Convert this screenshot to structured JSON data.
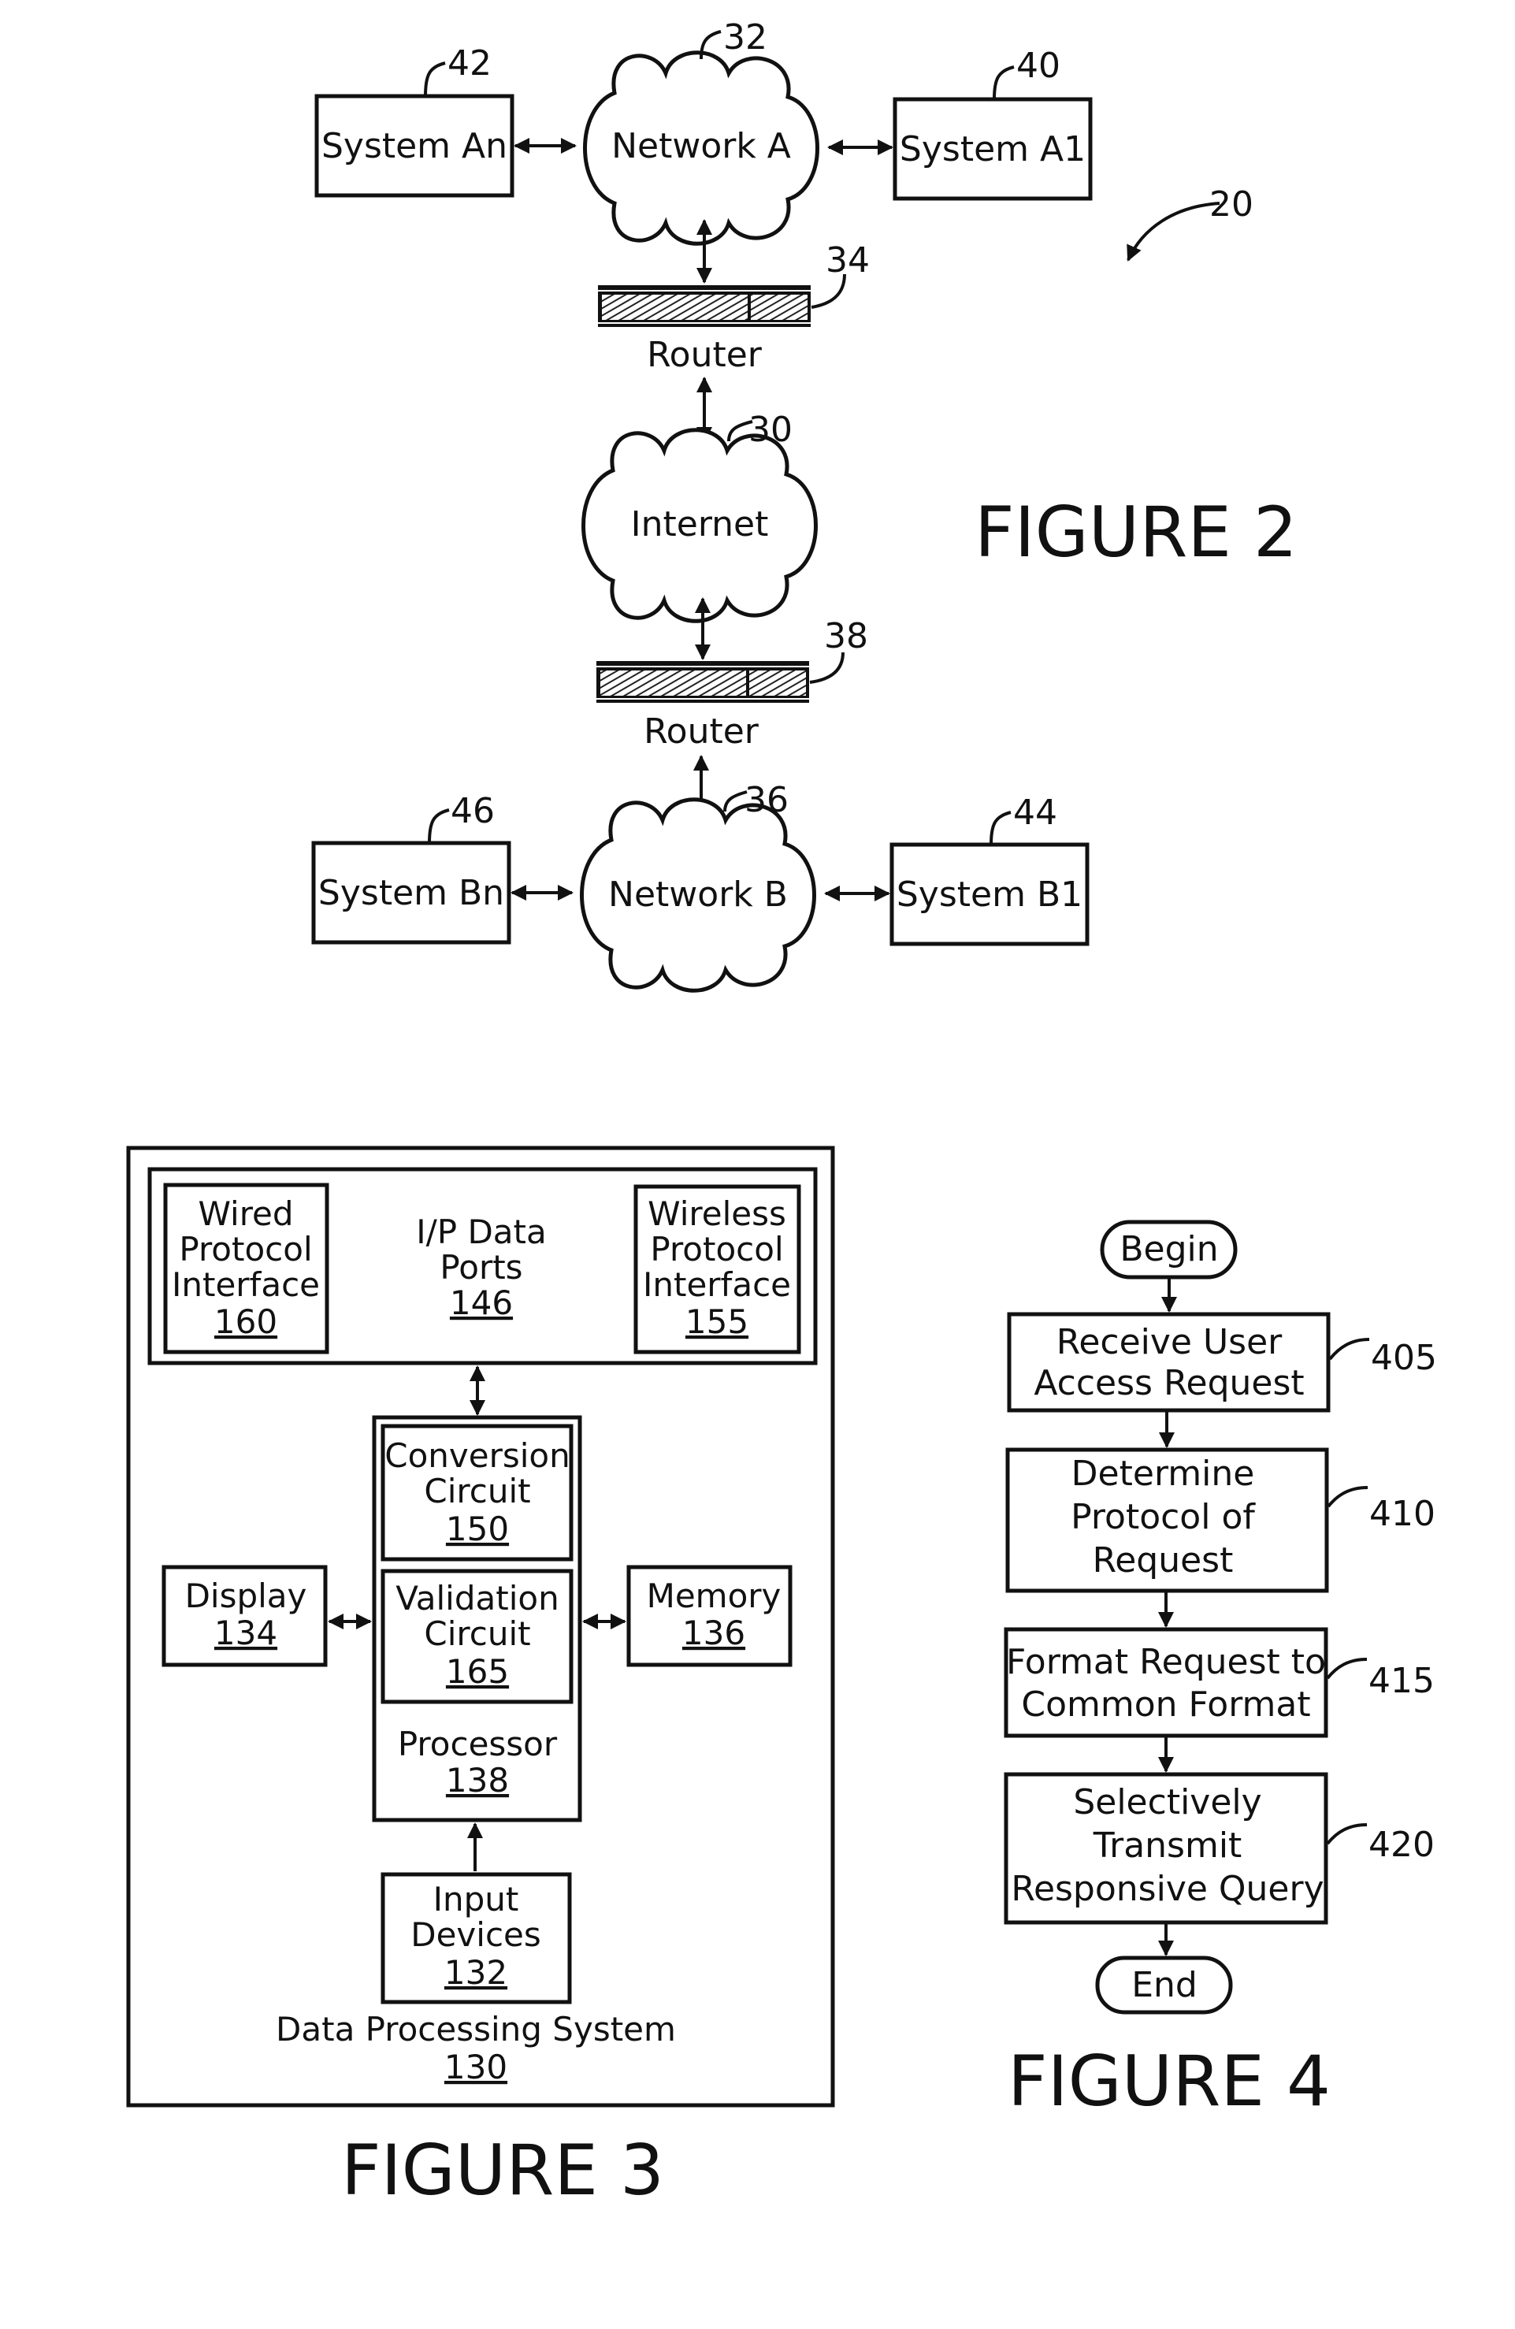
{
  "figure2": {
    "caption": "FIGURE 2",
    "ref": "20",
    "system_an": {
      "label": "System An",
      "ref": "42"
    },
    "network_a": {
      "label": "Network A",
      "ref": "32"
    },
    "system_a1": {
      "label": "System A1",
      "ref": "40"
    },
    "router_a": {
      "label": "Router",
      "ref": "34"
    },
    "internet": {
      "label": "Internet",
      "ref": "30"
    },
    "router_b": {
      "label": "Router",
      "ref": "38"
    },
    "system_bn": {
      "label": "System Bn",
      "ref": "46"
    },
    "network_b": {
      "label": "Network B",
      "ref": "36"
    },
    "system_b1": {
      "label": "System B1",
      "ref": "44"
    }
  },
  "figure3": {
    "caption": "FIGURE 3",
    "system": {
      "label": "Data Processing System",
      "ref": "130"
    },
    "io_ports": {
      "line1": "I/P Data",
      "line2": "Ports",
      "ref": "146"
    },
    "wired": {
      "line1": "Wired",
      "line2": "Protocol",
      "line3": "Interface",
      "ref": "160"
    },
    "wireless": {
      "line1": "Wireless",
      "line2": "Protocol",
      "line3": "Interface",
      "ref": "155"
    },
    "conversion": {
      "line1": "Conversion",
      "line2": "Circuit",
      "ref": "150"
    },
    "validation": {
      "line1": "Validation",
      "line2": "Circuit",
      "ref": "165"
    },
    "processor": {
      "label": "Processor",
      "ref": "138"
    },
    "display": {
      "label": "Display",
      "ref": "134"
    },
    "memory": {
      "label": "Memory",
      "ref": "136"
    },
    "input": {
      "line1": "Input",
      "line2": "Devices",
      "ref": "132"
    }
  },
  "figure4": {
    "caption": "FIGURE 4",
    "begin": "Begin",
    "end": "End",
    "steps": [
      {
        "lines": [
          "Receive User",
          "Access Request"
        ],
        "ref": "405"
      },
      {
        "lines": [
          "Determine",
          "Protocol of",
          "Request"
        ],
        "ref": "410"
      },
      {
        "lines": [
          "Format Request to",
          "Common Format"
        ],
        "ref": "415"
      },
      {
        "lines": [
          "Selectively",
          "Transmit",
          "Responsive Query"
        ],
        "ref": "420"
      }
    ]
  }
}
